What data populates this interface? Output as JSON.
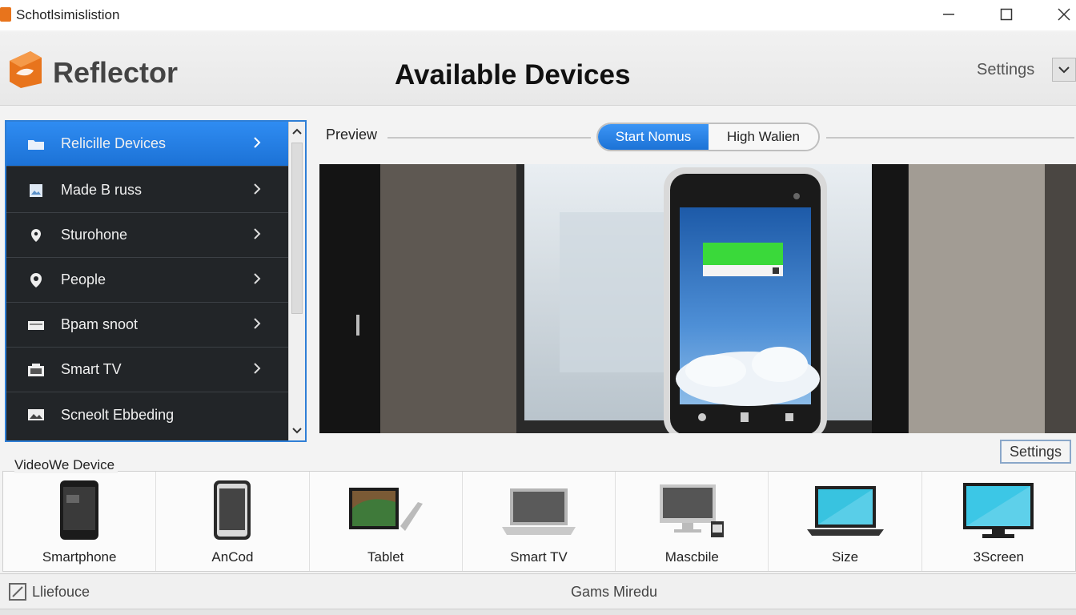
{
  "window": {
    "title": "Schotlsimislistion"
  },
  "header": {
    "brand": "Reflector",
    "page_title": "Available Devices",
    "settings_label": "Settings"
  },
  "sidebar": {
    "items": [
      {
        "label": "Relicille Devices",
        "icon": "folder-icon",
        "active": true
      },
      {
        "label": "Made B russ",
        "icon": "image-icon"
      },
      {
        "label": "Sturohone",
        "icon": "location-pin-icon"
      },
      {
        "label": "People",
        "icon": "map-marker-icon"
      },
      {
        "label": "Bpam snoot",
        "icon": "card-icon"
      },
      {
        "label": "Smart TV",
        "icon": "tv-icon"
      },
      {
        "label": "Scneolt Ebbeding",
        "icon": "photo-icon"
      }
    ]
  },
  "preview": {
    "label": "Preview",
    "segment": {
      "option_a": "Start Nomus",
      "option_b": "High Walien",
      "selected": "option_a"
    },
    "settings_button": "Settings"
  },
  "devices": {
    "title": "VideoWe Device",
    "items": [
      {
        "label": "Smartphone",
        "icon": "smartphone-icon"
      },
      {
        "label": "AnCod",
        "icon": "phone-icon"
      },
      {
        "label": "Tablet",
        "icon": "tablet-icon"
      },
      {
        "label": "Smart TV",
        "icon": "laptop-icon"
      },
      {
        "label": "Mascbile",
        "icon": "desktop-icon"
      },
      {
        "label": "Size",
        "icon": "laptop-blue-icon"
      },
      {
        "label": "3Screen",
        "icon": "monitor-icon"
      }
    ]
  },
  "status": {
    "left": "Lliefouce",
    "center": "Gams Miredu"
  },
  "colors": {
    "accent": "#1c72d6",
    "sidebar_bg": "#222528",
    "logo": "#e8741c"
  }
}
